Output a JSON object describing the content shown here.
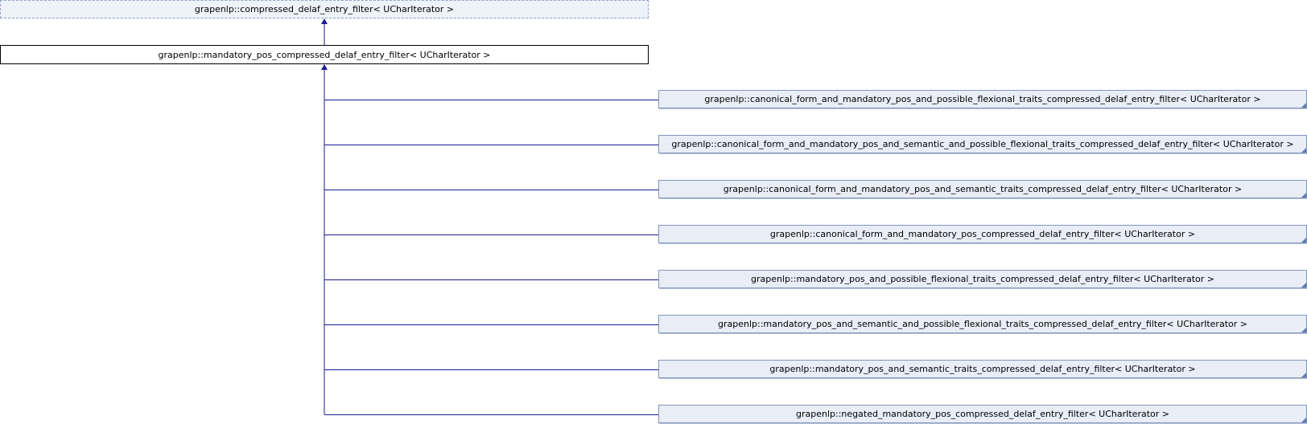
{
  "diagram": {
    "parent": "grapenlp::compressed_delaf_entry_filter< UCharIterator >",
    "current": "grapenlp::mandatory_pos_compressed_delaf_entry_filter< UCharIterator >",
    "children": [
      "grapenlp::canonical_form_and_mandatory_pos_and_possible_flexional_traits_compressed_delaf_entry_filter< UCharIterator >",
      "grapenlp::canonical_form_and_mandatory_pos_and_semantic_and_possible_flexional_traits_compressed_delaf_entry_filter< UCharIterator >",
      "grapenlp::canonical_form_and_mandatory_pos_and_semantic_traits_compressed_delaf_entry_filter< UCharIterator >",
      "grapenlp::canonical_form_and_mandatory_pos_compressed_delaf_entry_filter< UCharIterator >",
      "grapenlp::mandatory_pos_and_possible_flexional_traits_compressed_delaf_entry_filter< UCharIterator >",
      "grapenlp::mandatory_pos_and_semantic_and_possible_flexional_traits_compressed_delaf_entry_filter< UCharIterator >",
      "grapenlp::mandatory_pos_and_semantic_traits_compressed_delaf_entry_filter< UCharIterator >",
      "grapenlp::negated_mandatory_pos_compressed_delaf_entry_filter< UCharIterator >"
    ],
    "colors": {
      "edge": "#1b1b8f",
      "parent_border": "#8fa3c7",
      "child_fill": "#e8edf6"
    }
  }
}
